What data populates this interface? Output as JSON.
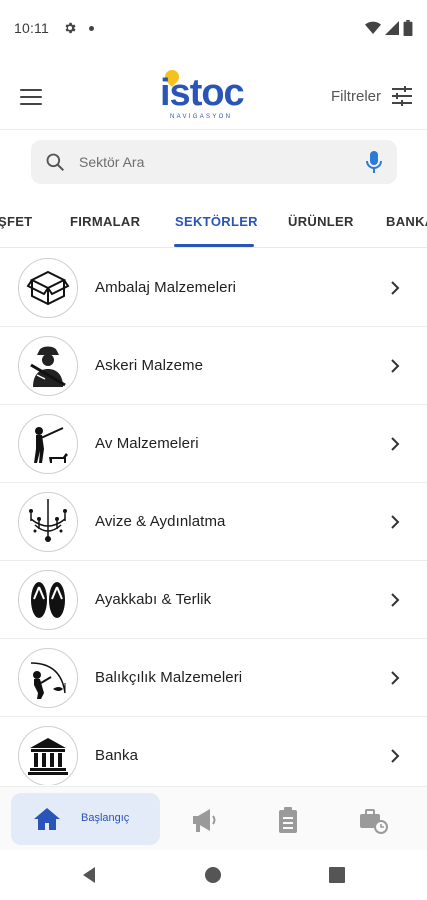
{
  "status_bar": {
    "time": "10:11",
    "icons": [
      "settings-icon",
      "notification-dot",
      "wifi-icon",
      "signal-icon",
      "battery-icon"
    ]
  },
  "app_bar": {
    "logo_text": "istoc",
    "logo_subtext": "NAVIGASYON",
    "filter_label": "Filtreler"
  },
  "search": {
    "placeholder": "Sektör Ara"
  },
  "tabs": [
    {
      "label": "ŞFET",
      "active": false
    },
    {
      "label": "FIRMALAR",
      "active": false
    },
    {
      "label": "SEKTÖRLER",
      "active": true
    },
    {
      "label": "ÜRÜNLER",
      "active": false
    },
    {
      "label": "BANKA",
      "active": false
    }
  ],
  "sectors": [
    {
      "name": "Ambalaj Malzemeleri",
      "icon": "box-icon"
    },
    {
      "name": "Askeri Malzeme",
      "icon": "soldier-icon"
    },
    {
      "name": "Av Malzemeleri",
      "icon": "hunter-icon"
    },
    {
      "name": "Avize & Aydınlatma",
      "icon": "chandelier-icon"
    },
    {
      "name": "Ayakkabı & Terlik",
      "icon": "flip-flops-icon"
    },
    {
      "name": "Balıkçılık Malzemeleri",
      "icon": "fishing-icon"
    },
    {
      "name": "Banka",
      "icon": "bank-icon"
    }
  ],
  "bottom_nav": {
    "home_label": "Başlangıç",
    "items": [
      "home-icon",
      "megaphone-icon",
      "clipboard-icon",
      "briefcase-clock-icon"
    ]
  },
  "colors": {
    "accent": "#2a55b8",
    "logo_pin": "#f4c21a",
    "mic": "#2a7bd8"
  }
}
